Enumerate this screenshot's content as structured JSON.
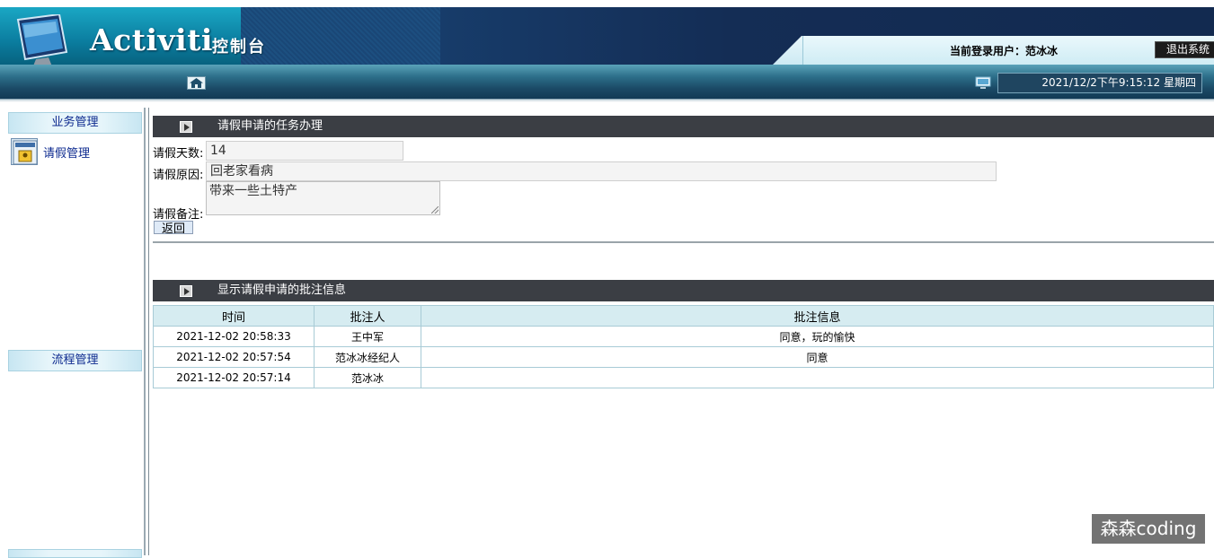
{
  "header": {
    "app_title": "Activiti",
    "app_subtitle": "控制台",
    "current_user_label": "当前登录用户：范冰冰",
    "logout_label": "退出系统",
    "datetime": "2021/12/2下午9:15:12 星期四"
  },
  "sidebar": {
    "section_business": "业务管理",
    "item_leave": "请假管理",
    "section_process": "流程管理"
  },
  "task_panel": {
    "title": "请假申请的任务办理",
    "days_label": "请假天数:",
    "days_value": "14",
    "reason_label": "请假原因:",
    "reason_value": "回老家看病",
    "remark_label": "请假备注:",
    "remark_value": "带来一些土特产",
    "back_label": "返回"
  },
  "comments_panel": {
    "title": "显示请假申请的批注信息",
    "headers": [
      "时间",
      "批注人",
      "批注信息"
    ],
    "rows": [
      [
        "2021-12-02 20:58:33",
        "王中军",
        "同意，玩的愉快"
      ],
      [
        "2021-12-02 20:57:54",
        "范冰冰经纪人",
        "同意"
      ],
      [
        "2021-12-02 20:57:14",
        "范冰冰",
        ""
      ]
    ]
  },
  "watermark": "森森coding"
}
